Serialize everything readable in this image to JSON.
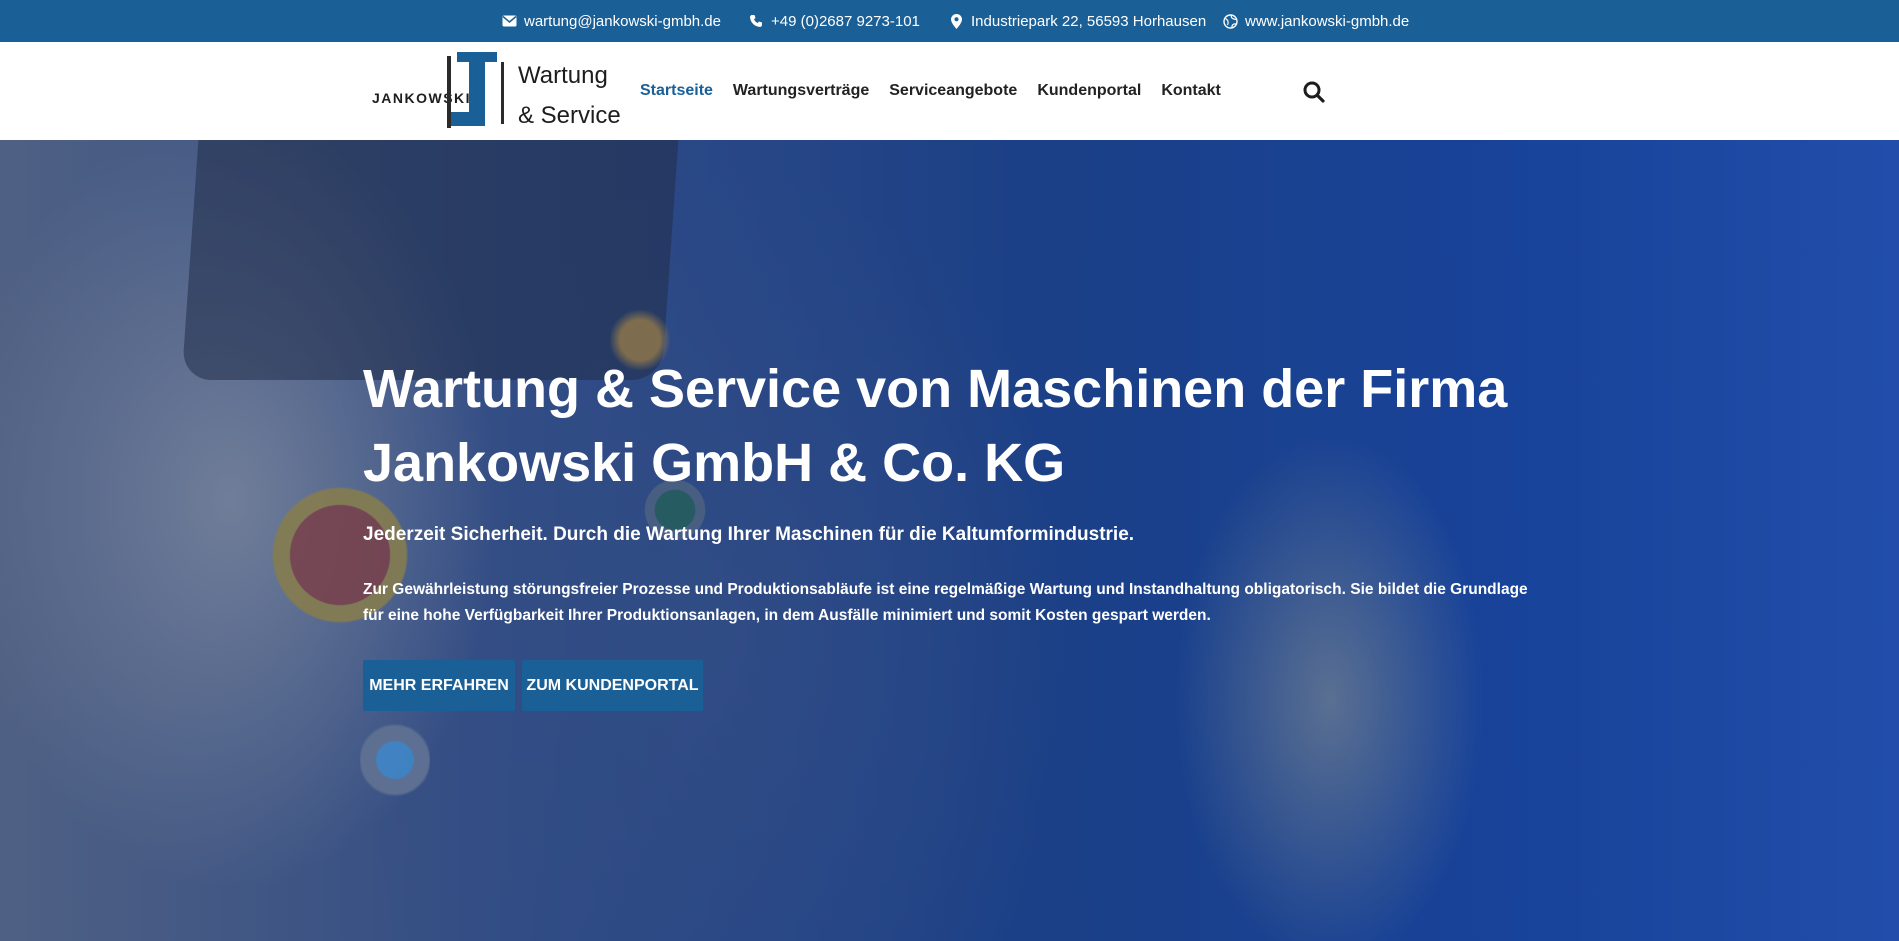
{
  "topbar": {
    "email": "wartung@jankowski-gmbh.de",
    "phone": "+49 (0)2687 9273-101",
    "address": "Industriepark 22, 56593 Horhausen",
    "website": "www.jankowski-gmbh.de",
    "icons": [
      "envelope-icon",
      "phone-icon",
      "map-pin-icon",
      "globe-icon"
    ]
  },
  "logo": {
    "brand": "JANKOWSKI",
    "line1": "Wartung",
    "line2": "& Service"
  },
  "nav": {
    "items": [
      "Startseite",
      "Wartungsverträge",
      "Serviceangebote",
      "Kundenportal",
      "Kontakt"
    ],
    "active": "Startseite",
    "search_icon": "search-icon"
  },
  "hero": {
    "title": "Wartung & Service von Maschinen der Firma Jankowski GmbH & Co. KG",
    "subtitle": "Jederzeit Sicherheit. Durch die Wartung Ihrer Maschinen für die Kaltumformindustrie.",
    "text": "Zur Gewährleistung störungsfreier Prozesse und Produktionsabläufe ist eine regelmäßige Wartung und Instandhaltung obligatorisch. Sie bildet die Grundlage für eine hohe Verfügbarkeit Ihrer Produktionsanlagen, in dem Ausfälle minimiert und somit Kosten gespart werden.",
    "button_more": "MEHR ERFAHREN",
    "button_portal": "ZUM KUNDENPORTAL"
  },
  "colors": {
    "brand_blue": "#1a5f96",
    "nav_text": "#222222",
    "white": "#ffffff"
  }
}
